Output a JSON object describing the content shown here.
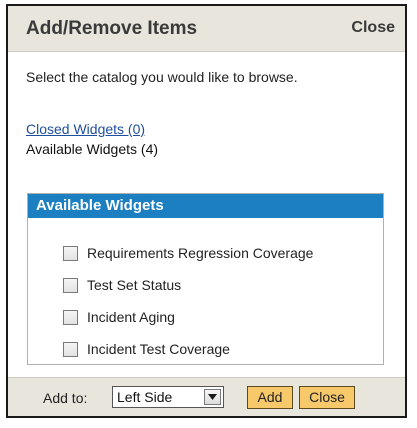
{
  "dialog": {
    "title": "Add/Remove Items",
    "close_label": "Close"
  },
  "instruction": "Select the catalog you would like to browse.",
  "catalog": {
    "closed_widgets_label": "Closed Widgets (0)",
    "available_widgets_label": "Available Widgets (4)"
  },
  "panel": {
    "title": "Available Widgets",
    "items": [
      {
        "label": "Requirements Regression Coverage",
        "checked": false
      },
      {
        "label": "Test Set Status",
        "checked": false
      },
      {
        "label": "Incident Aging",
        "checked": false
      },
      {
        "label": "Incident Test Coverage",
        "checked": false
      }
    ]
  },
  "footer": {
    "add_to_label": "Add to:",
    "select_value": "Left Side",
    "add_button": "Add",
    "close_button": "Close"
  },
  "colors": {
    "header_bg": "#e8e5dc",
    "panel_header_bg": "#1b7fc1",
    "button_bg": "#f7c96a",
    "link": "#1f4e9c"
  },
  "icons": {
    "select_arrow": "chevron-down-icon"
  }
}
